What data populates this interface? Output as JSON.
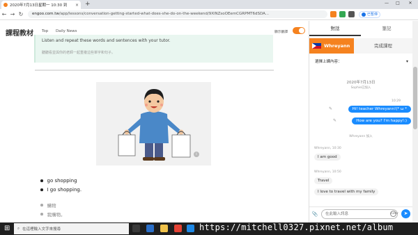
{
  "browser": {
    "tab_title": "2020年7月13日星期一 10:30 到",
    "tab_close": "×",
    "new_tab": "+",
    "url_host": "engoo.com.tw",
    "url_path": "/app/lessons/conversation-getting-started-what-does-she-do-on-the-weekend/9XlNZsoOEemCGRPMT6dSDA...",
    "profile_status": "已暫停",
    "window_controls": [
      "—",
      "□",
      "✕"
    ]
  },
  "header": {
    "logo": "課程教材",
    "nav": [
      "Top",
      "Daily News"
    ],
    "translate_label": "顯示翻譯"
  },
  "lesson": {
    "instruction_en": "Listen and repeat these words and sentences with your tutor.",
    "instruction_zh": "聽聽看並與你的老師一起重複這些單字和句子。",
    "info_icon": "i",
    "vocab": [
      "go shopping",
      "I go shopping."
    ],
    "vocab_zh": [
      "購物",
      "我購物。"
    ]
  },
  "panel": {
    "tabs": [
      "對話",
      "筆記"
    ],
    "tutor_name": "Whreyann",
    "completed_label": "完成課程",
    "select_label": "選擇上課內容：",
    "select_caret": "▾",
    "chat": {
      "date": "2020年7月13日",
      "student_joined": "Sophie已加入",
      "my_time": "10:29",
      "my_messages": [
        "Hi! teacher Whreyann!(* ω *",
        "How are you? I'm happy!:)"
      ],
      "tutor_joined": "Whreyann 加入",
      "tutor_time_1": "Whreyann, 10:30",
      "tutor_msg_1": "I am  good",
      "tutor_time_2": "Whreyann, 10:50",
      "tutor_msgs_2": [
        "Travel",
        "I love to travel with my family"
      ]
    },
    "input_placeholder": "在此輸入訊息",
    "emoji_label": "GIPHY",
    "send_icon": "➤",
    "attach_icon": "📎"
  },
  "taskbar": {
    "search_placeholder": "在這裡輸入文字來搜尋",
    "watermark": "https://mitchell0327.pixnet.net/album"
  }
}
